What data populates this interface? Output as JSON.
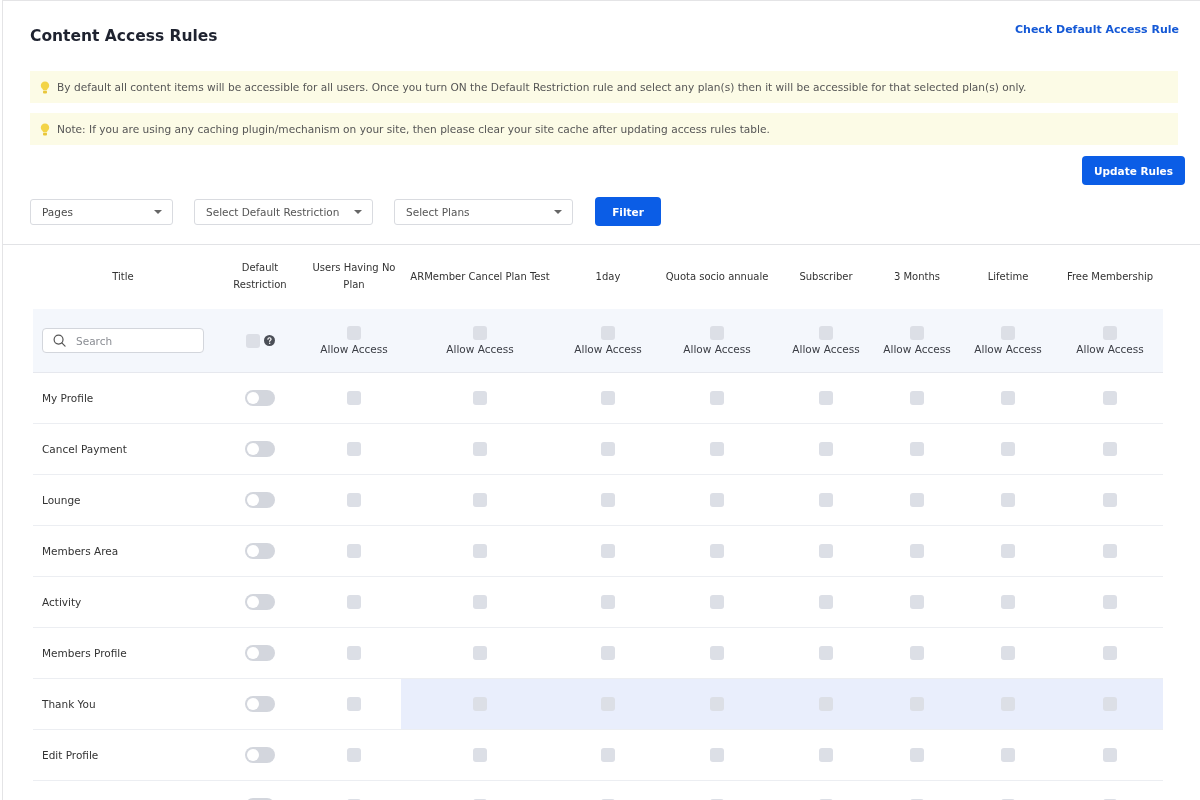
{
  "header": {
    "title": "Content Access Rules",
    "link": "Check Default Access Rule"
  },
  "notices": [
    "By default all content items will be accessible for all users. Once you turn ON the Default Restriction rule and select any plan(s) then it will be accessible for that selected plan(s) only.",
    "Note: If you are using any caching plugin/mechanism on your site, then please clear your site cache after updating access rules table."
  ],
  "update_button": "Update Rules",
  "filters": [
    {
      "value": "Pages"
    },
    {
      "placeholder": "Select Default Restriction"
    },
    {
      "placeholder": "Select Plans"
    }
  ],
  "filter_button": "Filter",
  "table": {
    "columns": [
      "Title",
      "Default Restriction"
    ],
    "plans": [
      {
        "name": "Users Having No Plan",
        "allow_label": "Allow Access",
        "allow_all": false
      },
      {
        "name": "ARMember Cancel Plan Test",
        "allow_label": "Allow Access",
        "allow_all": false
      },
      {
        "name": "1day",
        "allow_label": "Allow Access",
        "allow_all": false
      },
      {
        "name": "Quota socio annuale",
        "allow_label": "Allow Access",
        "allow_all": false
      },
      {
        "name": "Subscriber",
        "allow_label": "Allow Access",
        "allow_all": false
      },
      {
        "name": "3 Months",
        "allow_label": "Allow Access",
        "allow_all": false
      },
      {
        "name": "Lifetime",
        "allow_label": "Allow Access",
        "allow_all": false
      },
      {
        "name": "Free Membership",
        "allow_label": "Allow Access",
        "allow_all": false
      }
    ],
    "search": {
      "placeholder": "Search"
    },
    "default_restriction_all": false,
    "rows": [
      {
        "title": "My Profile",
        "restricted": false,
        "access": [
          false,
          false,
          false,
          false,
          false,
          false,
          false,
          false
        ]
      },
      {
        "title": "Cancel Payment",
        "restricted": false,
        "access": [
          false,
          false,
          false,
          false,
          false,
          false,
          false,
          false
        ]
      },
      {
        "title": "Lounge",
        "restricted": false,
        "access": [
          false,
          false,
          false,
          false,
          false,
          false,
          false,
          false
        ]
      },
      {
        "title": "Members Area",
        "restricted": false,
        "access": [
          false,
          false,
          false,
          false,
          false,
          false,
          false,
          false
        ]
      },
      {
        "title": "Activity",
        "restricted": false,
        "access": [
          false,
          false,
          false,
          false,
          false,
          false,
          false,
          false
        ]
      },
      {
        "title": "Members Profile",
        "restricted": false,
        "access": [
          false,
          false,
          false,
          false,
          false,
          false,
          false,
          false
        ]
      },
      {
        "title": "Thank You",
        "restricted": false,
        "highlighted": true,
        "access": [
          false,
          false,
          false,
          false,
          false,
          false,
          false,
          false
        ]
      },
      {
        "title": "Edit Profile",
        "restricted": false,
        "access": [
          false,
          false,
          false,
          false,
          false,
          false,
          false,
          false
        ]
      },
      {
        "restricted": false,
        "access": [
          false,
          false,
          false,
          false,
          false,
          false,
          false,
          false
        ]
      }
    ]
  }
}
